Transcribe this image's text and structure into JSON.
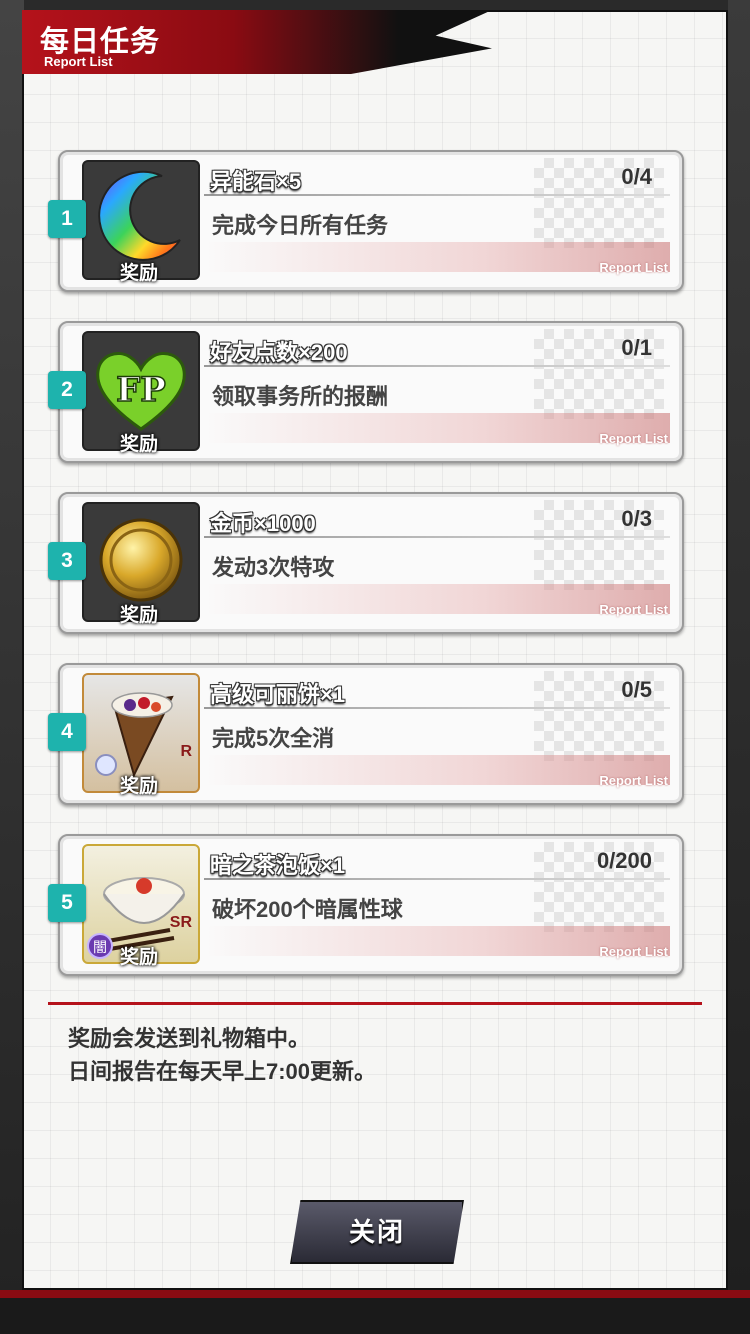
{
  "header": {
    "title": "每日任务",
    "subtitle": "Report List"
  },
  "missions": [
    {
      "num": "1",
      "reward_name": "异能石×5",
      "progress": "0/4",
      "description": "完成今日所有任务",
      "reward_label": "奖励",
      "tag": "Report List",
      "icon": "rainbow-crescent-stone-icon"
    },
    {
      "num": "2",
      "reward_name": "好友点数×200",
      "progress": "0/1",
      "description": "领取事务所的报酬",
      "reward_label": "奖励",
      "tag": "Report List",
      "icon": "fp-heart-icon",
      "icon_text": "FP"
    },
    {
      "num": "3",
      "reward_name": "金币×1000",
      "progress": "0/3",
      "description": "发动3次特攻",
      "reward_label": "奖励",
      "tag": "Report List",
      "icon": "gold-coin-icon"
    },
    {
      "num": "4",
      "reward_name": "高级可丽饼×1",
      "progress": "0/5",
      "description": "完成5次全消",
      "reward_label": "奖励",
      "tag": "Report List",
      "icon": "crepe-icon",
      "rarity": "R"
    },
    {
      "num": "5",
      "reward_name": "暗之茶泡饭×1",
      "progress": "0/200",
      "description": "破坏200个暗属性球",
      "reward_label": "奖励",
      "tag": "Report List",
      "icon": "ochazuke-bowl-icon",
      "rarity": "SR",
      "attribute": "闇"
    }
  ],
  "notes": {
    "line1": "奖励会发送到礼物箱中。",
    "line2": "日间报告在每天早上7:00更新。"
  },
  "buttons": {
    "close": "关闭"
  },
  "colors": {
    "accent_red": "#b5121b",
    "badge_teal": "#1eb3ad"
  }
}
